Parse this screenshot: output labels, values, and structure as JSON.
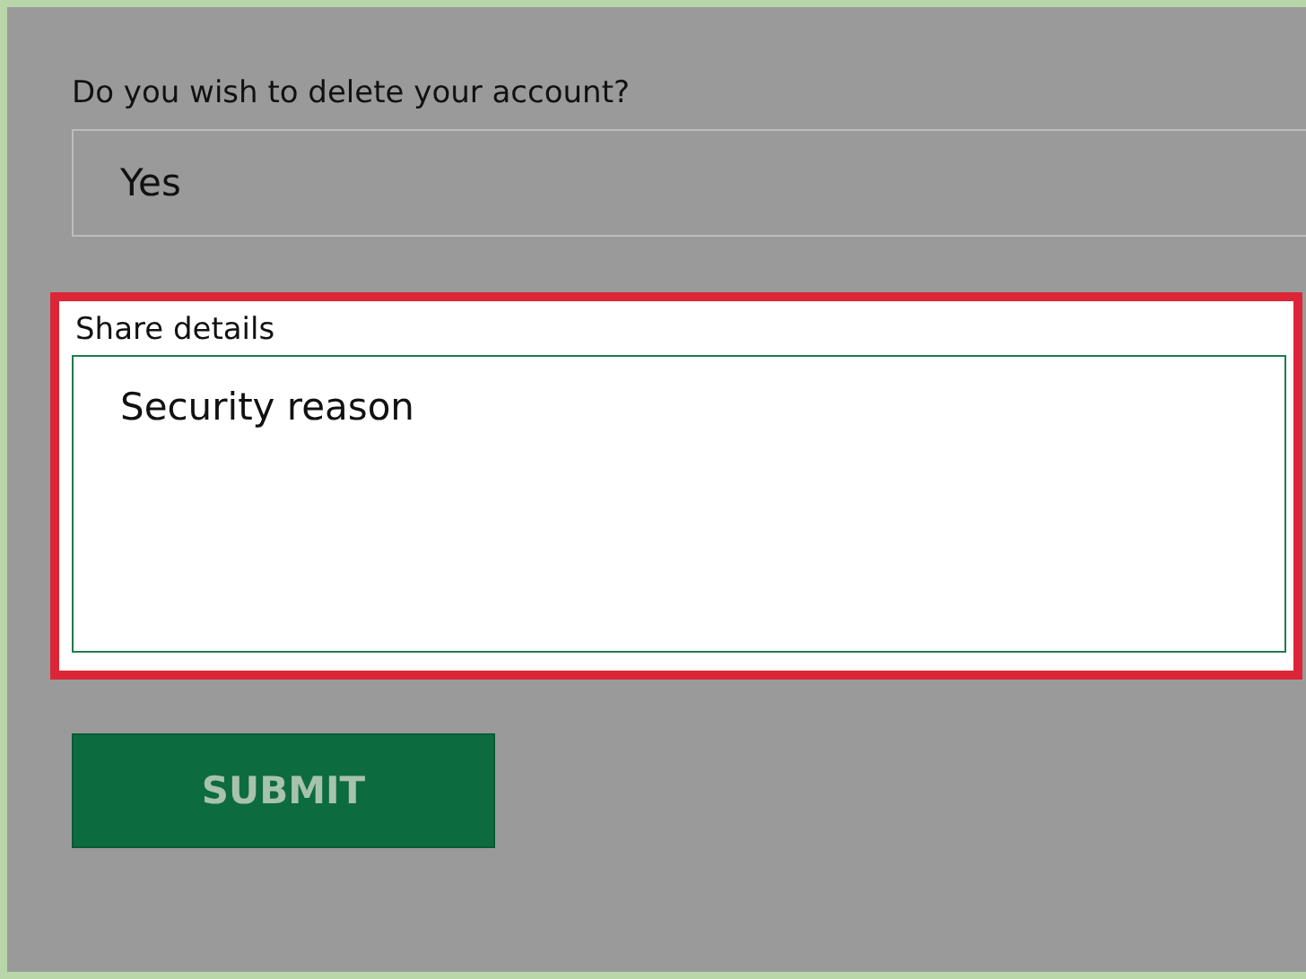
{
  "question": {
    "label": "Do you wish to delete your account?",
    "value": "Yes"
  },
  "details": {
    "label": "Share details",
    "value": "Security reason",
    "highlighted": true
  },
  "submit": {
    "label": "SUBMIT"
  }
}
